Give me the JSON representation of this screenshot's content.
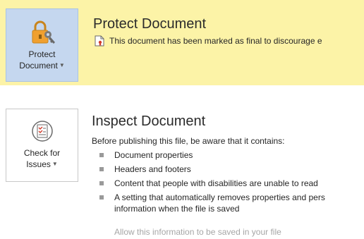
{
  "protect": {
    "button_line1": "Protect",
    "button_line2": "Document",
    "title": "Protect Document",
    "description": "This document has been marked as final to discourage e",
    "accent_color": "#fcf3a7",
    "icon": "lock-key-icon"
  },
  "inspect": {
    "button_line1": "Check for",
    "button_line2": "Issues",
    "title": "Inspect Document",
    "intro": "Before publishing this file, be aware that it contains:",
    "items": [
      {
        "line1": "Document properties",
        "line2": ""
      },
      {
        "line1": "Headers and footers",
        "line2": ""
      },
      {
        "line1": "Content that people with disabilities are unable to read",
        "line2": ""
      },
      {
        "line1": "A setting that automatically removes properties and pers",
        "line2": "information when the file is saved"
      }
    ],
    "allow_link": "Allow this information to be saved in your file",
    "icon": "checklist-icon"
  }
}
